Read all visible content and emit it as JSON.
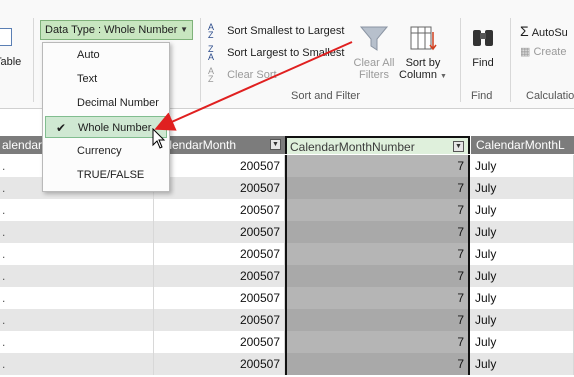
{
  "ribbon": {
    "table_label": "Table",
    "data_type_button": "Data Type : Whole Number",
    "sort_smallest": "Sort Smallest to Largest",
    "sort_largest": "Sort Largest to Smallest",
    "clear_sort": "Clear Sort",
    "clear_all_filters_1": "Clear All",
    "clear_all_filters_2": "Filters",
    "sort_by_column_1": "Sort by",
    "sort_by_column_2": "Column",
    "find": "Find",
    "autosum": "AutoSu",
    "create": "Create",
    "group_sort_filter": "Sort and Filter",
    "group_find": "Find",
    "group_calc": "Calculatio"
  },
  "data_type_menu": {
    "items": [
      "Auto",
      "Text",
      "Decimal Number",
      "Whole Number",
      "Currency",
      "TRUE/FALSE"
    ],
    "selected": "Whole Number"
  },
  "grid": {
    "headers": [
      "alendar",
      "CalendarMonth",
      "CalendarMonthNumber",
      "CalendarMonthL"
    ],
    "rows": [
      {
        "month": "200507",
        "number": "7",
        "label": "July"
      },
      {
        "month": "200507",
        "number": "7",
        "label": "July"
      },
      {
        "month": "200507",
        "number": "7",
        "label": "July"
      },
      {
        "month": "200507",
        "number": "7",
        "label": "July"
      },
      {
        "month": "200507",
        "number": "7",
        "label": "July"
      },
      {
        "month": "200507",
        "number": "7",
        "label": "July"
      },
      {
        "month": "200507",
        "number": "7",
        "label": "July"
      },
      {
        "month": "200507",
        "number": "7",
        "label": "July"
      },
      {
        "month": "200507",
        "number": "7",
        "label": "July"
      },
      {
        "month": "200507",
        "number": "7",
        "label": "July"
      }
    ]
  },
  "colors": {
    "data_type_button": "#c8e6c0",
    "highlight_header": "#dff0dc",
    "header_bg": "#7c7c7c",
    "arrow": "#e02020"
  }
}
